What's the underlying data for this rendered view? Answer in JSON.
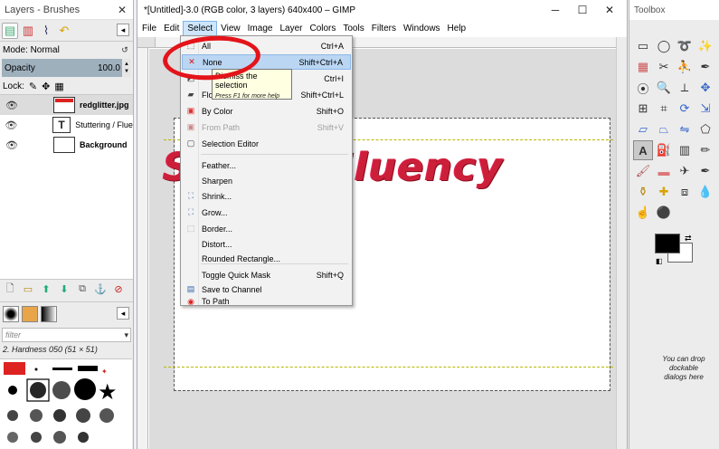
{
  "left_panel": {
    "title": "Layers - Brushes",
    "mode_label": "Mode: Normal",
    "opacity_label": "Opacity",
    "opacity_value": "100.0",
    "lock_label": "Lock:",
    "layers": [
      {
        "name": "redglitter.jpg",
        "selected": true
      },
      {
        "name": "Stuttering / Fluen",
        "selected": false
      },
      {
        "name": "Background",
        "selected": false
      }
    ],
    "filter_placeholder": "filter",
    "brush_name": "2. Hardness 050 (51 × 51)"
  },
  "main_window": {
    "title": "*[Untitled]-3.0 (RGB color, 3 layers) 640x400 – GIMP",
    "menus": [
      "File",
      "Edit",
      "Select",
      "View",
      "Image",
      "Layer",
      "Colors",
      "Tools",
      "Filters",
      "Windows",
      "Help"
    ],
    "canvas_text": "St          ng / Fluency"
  },
  "select_menu": {
    "items": [
      {
        "label": "All",
        "shortcut": "Ctrl+A",
        "icon": "select-all-icon"
      },
      {
        "label": "None",
        "shortcut": "Shift+Ctrl+A",
        "icon": "select-none-icon",
        "highlighted": true
      },
      {
        "label": "",
        "shortcut": "Ctrl+I",
        "icon": "invert-icon"
      },
      {
        "label": "Floa",
        "shortcut": "Shift+Ctrl+L",
        "icon": "float-icon"
      },
      {
        "label": "By Color",
        "shortcut": "Shift+O",
        "icon": "by-color-icon"
      },
      {
        "label": "From Path",
        "shortcut": "Shift+V",
        "icon": "from-path-icon",
        "disabled": true
      },
      {
        "label": "Selection Editor",
        "shortcut": "",
        "icon": "selection-editor-icon"
      },
      {
        "label": "Feather...",
        "shortcut": "",
        "icon": ""
      },
      {
        "label": "Sharpen",
        "shortcut": "",
        "icon": ""
      },
      {
        "label": "Shrink...",
        "shortcut": "",
        "icon": "shrink-icon"
      },
      {
        "label": "Grow...",
        "shortcut": "",
        "icon": "grow-icon"
      },
      {
        "label": "Border...",
        "shortcut": "",
        "icon": "border-icon"
      },
      {
        "label": "Distort...",
        "shortcut": "",
        "icon": ""
      },
      {
        "label": "Rounded Rectangle...",
        "shortcut": "",
        "icon": ""
      },
      {
        "label": "Toggle Quick Mask",
        "shortcut": "Shift+Q",
        "icon": ""
      },
      {
        "label": "Save to Channel",
        "shortcut": "",
        "icon": "save-channel-icon"
      },
      {
        "label": "To Path",
        "shortcut": "",
        "icon": "to-path-icon"
      }
    ],
    "tooltip_main": "Dismiss the selection",
    "tooltip_hint": "Press F1 for more help"
  },
  "toolbox": {
    "title": "Toolbox",
    "drop_note": "You can drop dockable dialogs here"
  },
  "colors": {
    "foreground": "#000000",
    "background": "#ffffff",
    "annotation": "#e3141a",
    "canvas_text": "#cc1f3a"
  }
}
